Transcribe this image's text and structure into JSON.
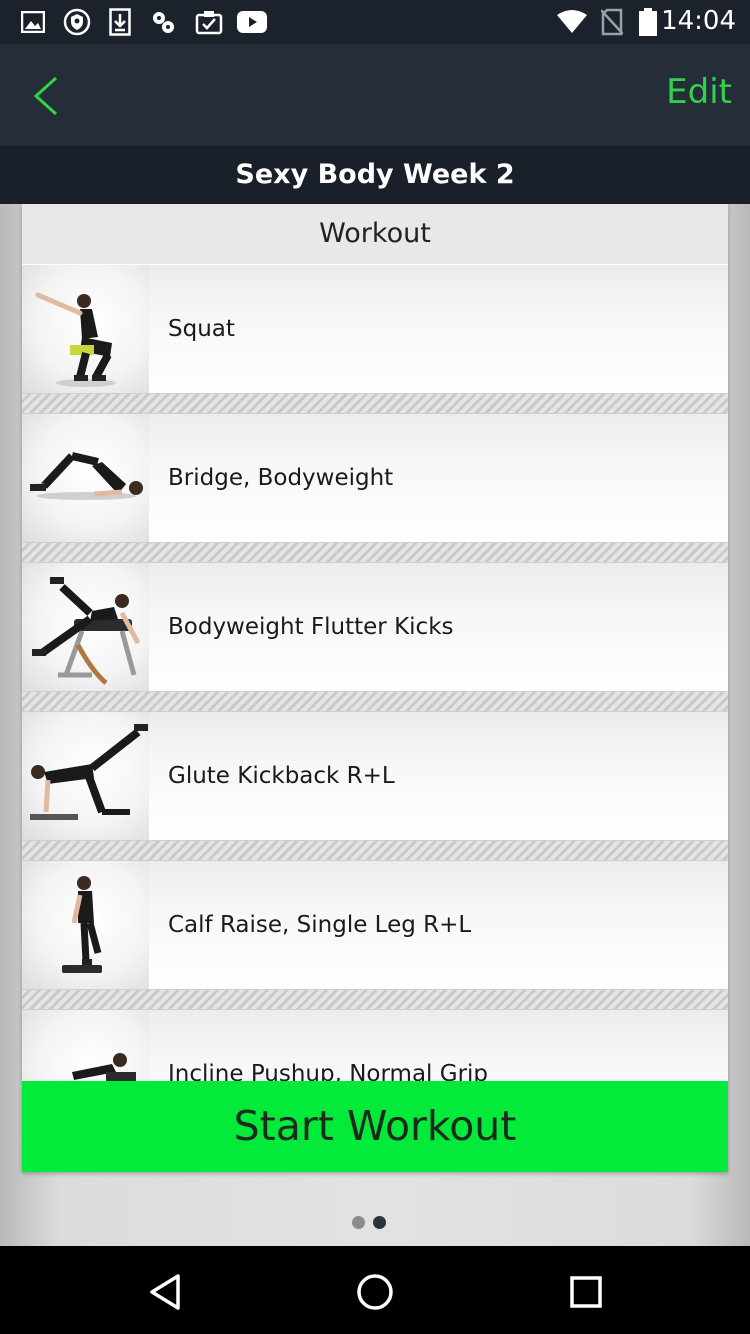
{
  "status_bar": {
    "time": "14:04",
    "icons": [
      "image-icon",
      "vpn-shield-icon",
      "download-icon",
      "settings-cog-icon",
      "clipboard-check-icon",
      "youtube-icon",
      "wifi-icon",
      "no-sim-icon",
      "battery-icon"
    ]
  },
  "nav": {
    "back_icon": "chevron-left-icon",
    "edit_label": "Edit",
    "accent_color": "#2fd24a"
  },
  "title": "Sexy Body Week 2",
  "card": {
    "header": "Workout",
    "exercises": [
      {
        "label": "Squat",
        "thumb": "squat-figure"
      },
      {
        "label": "Bridge, Bodyweight",
        "thumb": "bridge-figure"
      },
      {
        "label": "Bodyweight Flutter Kicks",
        "thumb": "flutter-kicks-figure"
      },
      {
        "label": "Glute Kickback R+L",
        "thumb": "glute-kickback-figure"
      },
      {
        "label": "Calf Raise, Single Leg R+L",
        "thumb": "calf-raise-figure"
      },
      {
        "label": "Incline Pushup, Normal Grip",
        "thumb": "incline-pushup-figure"
      }
    ],
    "start_button": "Start Workout",
    "start_color": "#03ea3b"
  },
  "pager": {
    "pages": 2,
    "active": 2
  },
  "android_nav": [
    "back-triangle-icon",
    "home-circle-icon",
    "recents-square-icon"
  ]
}
